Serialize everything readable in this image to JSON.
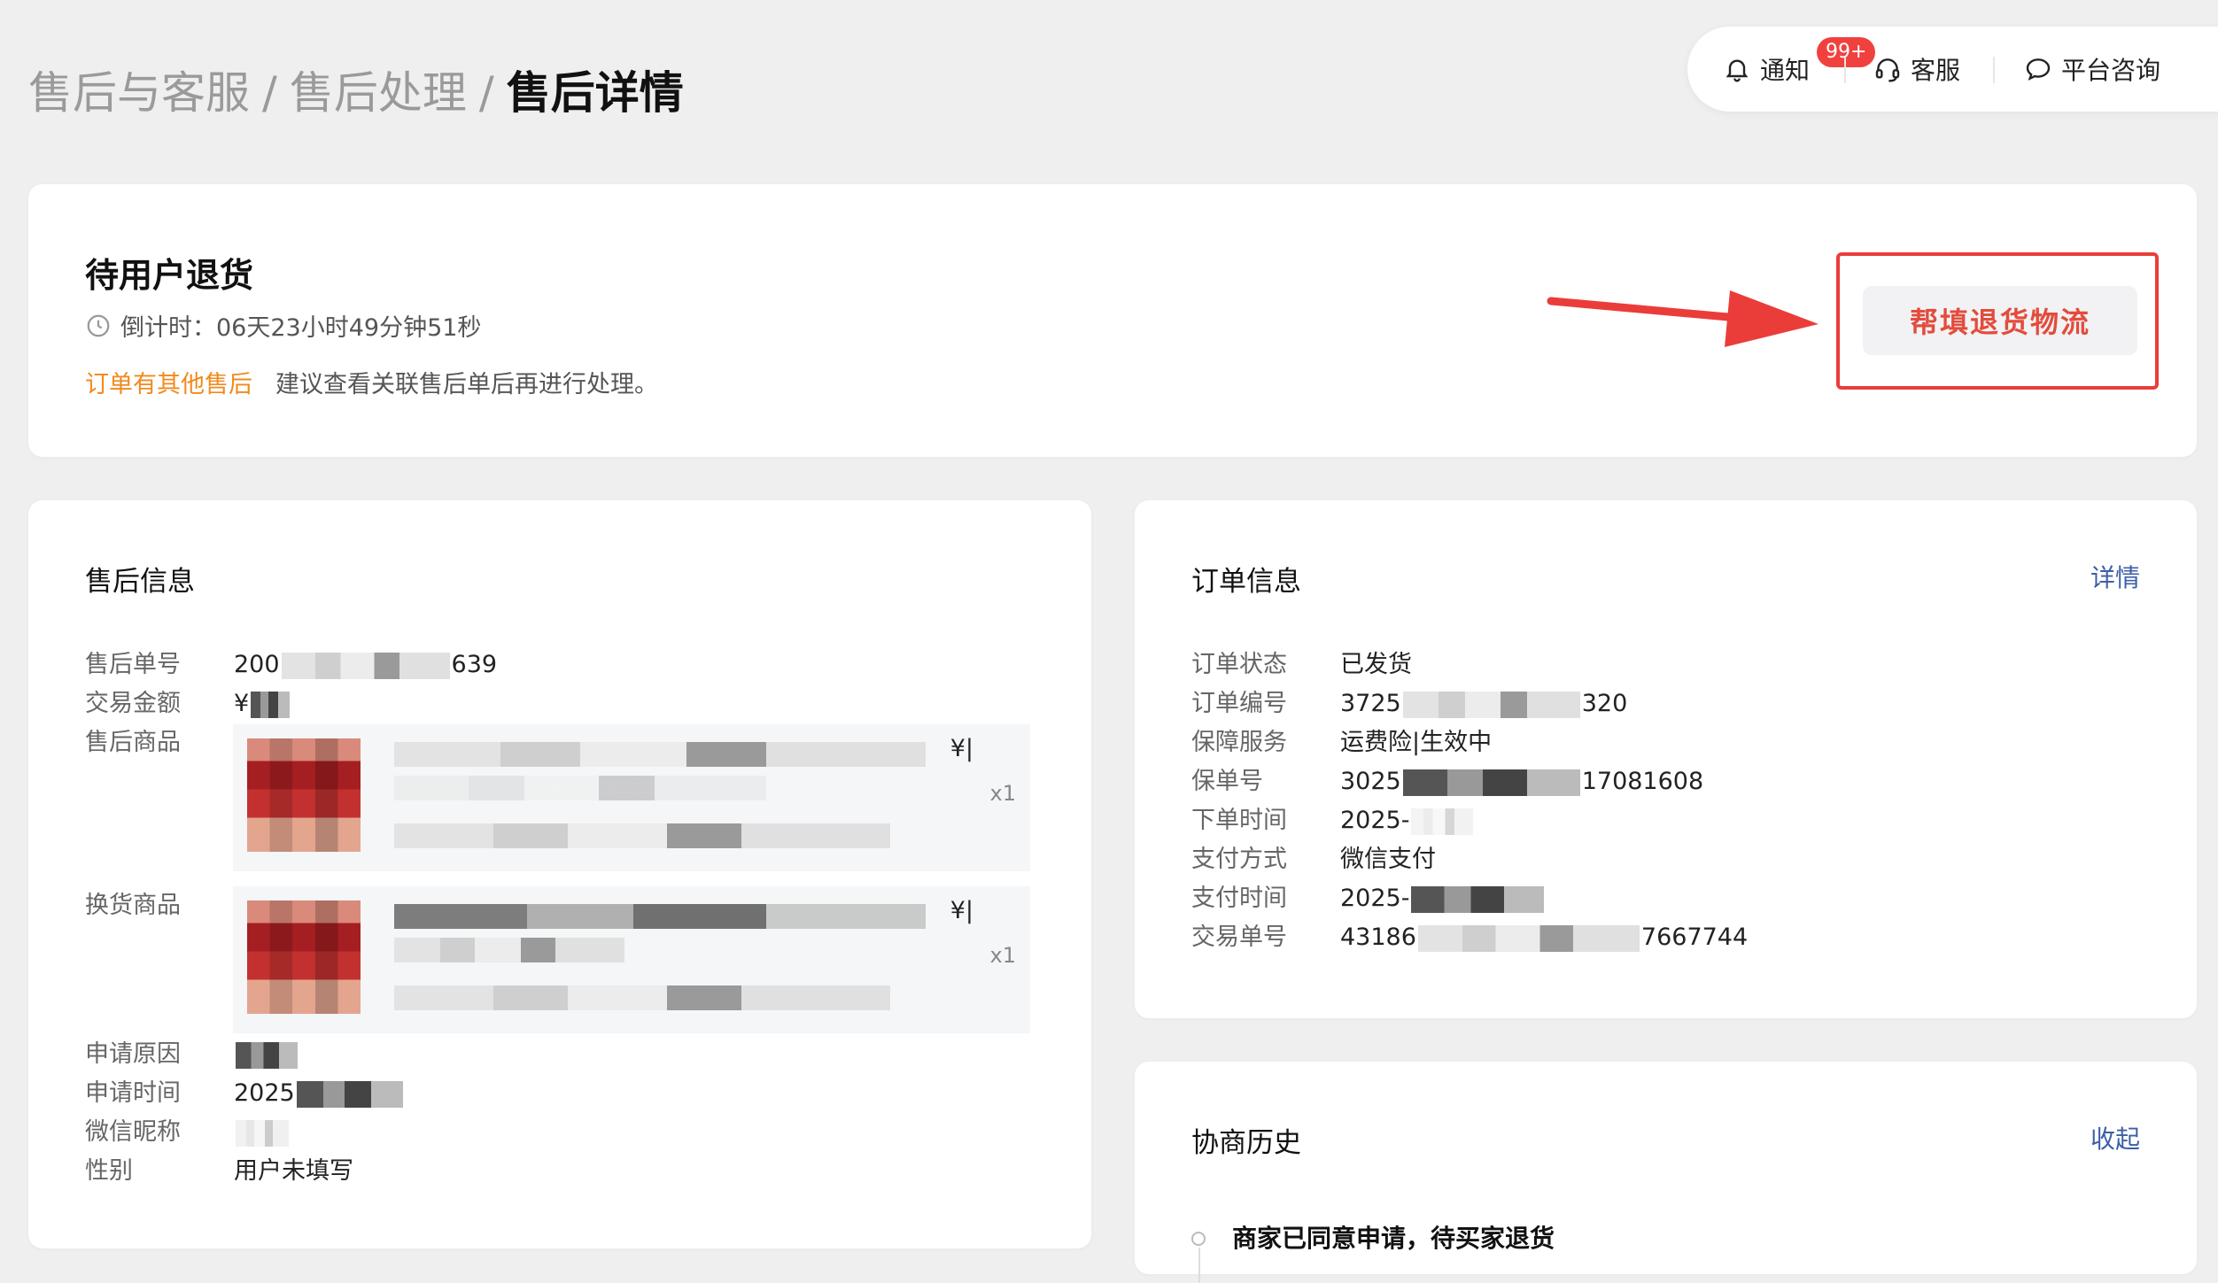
{
  "breadcrumb": {
    "item1": "售后与客服",
    "item2": "售后处理",
    "current": "售后详情",
    "separator": "/"
  },
  "topnav": {
    "notify_label": "通知",
    "notify_badge": "99+",
    "service_label": "客服",
    "consult_label": "平台咨询"
  },
  "status": {
    "title": "待用户退货",
    "countdown": "倒计时：06天23小时49分钟51秒",
    "other_aftersale_link": "订单有其他售后",
    "notice": "建议查看关联售后单后再进行处理。",
    "action_button": "帮填退货物流"
  },
  "aftersale": {
    "title": "售后信息",
    "rows": [
      {
        "label": "售后单号",
        "prefix": "200",
        "suffix": "639"
      },
      {
        "label": "交易金额",
        "prefix": "¥",
        "suffix": ""
      },
      {
        "label": "售后商品"
      },
      {
        "label": "换货商品"
      },
      {
        "label": "申请原因",
        "prefix": "",
        "suffix": ""
      },
      {
        "label": "申请时间",
        "prefix": "2025",
        "suffix": ""
      },
      {
        "label": "微信昵称",
        "prefix": "",
        "suffix": ""
      },
      {
        "label": "性别",
        "value": "用户未填写"
      }
    ],
    "product1": {
      "price": "¥|",
      "qty": "x1"
    },
    "product2": {
      "price": "¥|",
      "qty": "x1"
    }
  },
  "order": {
    "title": "订单信息",
    "detail_link": "详情",
    "rows": [
      {
        "label": "订单状态",
        "value": "已发货"
      },
      {
        "label": "订单编号",
        "prefix": "3725",
        "suffix": "320"
      },
      {
        "label": "保障服务",
        "value": "运费险|生效中"
      },
      {
        "label": "保单号",
        "prefix": "3025",
        "suffix": "17081608"
      },
      {
        "label": "下单时间",
        "prefix": "2025-",
        "suffix": ""
      },
      {
        "label": "支付方式",
        "value": "微信支付"
      },
      {
        "label": "支付时间",
        "prefix": "2025-",
        "suffix": ""
      },
      {
        "label": "交易单号",
        "prefix": "43186",
        "suffix": "7667744"
      }
    ]
  },
  "history": {
    "title": "协商历史",
    "collapse_link": "收起",
    "entries": [
      {
        "text": "商家已同意申请，待买家退货"
      }
    ]
  },
  "colors": {
    "accent_red": "#ea3d3a",
    "warn_orange": "#f18a1d",
    "link_blue": "#3d5fa8"
  }
}
